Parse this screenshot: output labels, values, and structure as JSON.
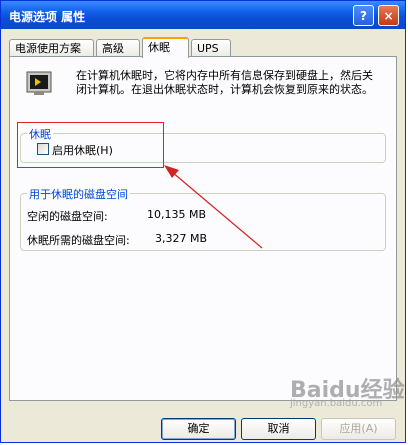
{
  "window": {
    "title": "电源选项 属性",
    "help_glyph": "?",
    "close_glyph": "×"
  },
  "tabs": [
    {
      "label": "电源使用方案"
    },
    {
      "label": "高级"
    },
    {
      "label": "休眠"
    },
    {
      "label": "UPS"
    }
  ],
  "description": "在计算机休眠时，它将内存中所有信息保存到硬盘上，然后关闭计算机。在退出休眠状态时，计算机会恢复到原来的状态。",
  "hibernate": {
    "group_label": "休眠",
    "checkbox_label": "启用休眠(H)"
  },
  "disk_space": {
    "group_label": "用于休眠的磁盘空间",
    "free_label": "空闲的磁盘空间:",
    "free_value": "10,135 MB",
    "required_label": "休眠所需的磁盘空间:",
    "required_value": "3,327 MB"
  },
  "buttons": {
    "ok": "确定",
    "cancel": "取消",
    "apply": "应用(A)"
  },
  "watermark": {
    "text": "Baidu经验",
    "url": "jingyan.baidu.com"
  },
  "colors": {
    "annotation_red": "#d22222",
    "title_blue": "#0b4fd6"
  }
}
